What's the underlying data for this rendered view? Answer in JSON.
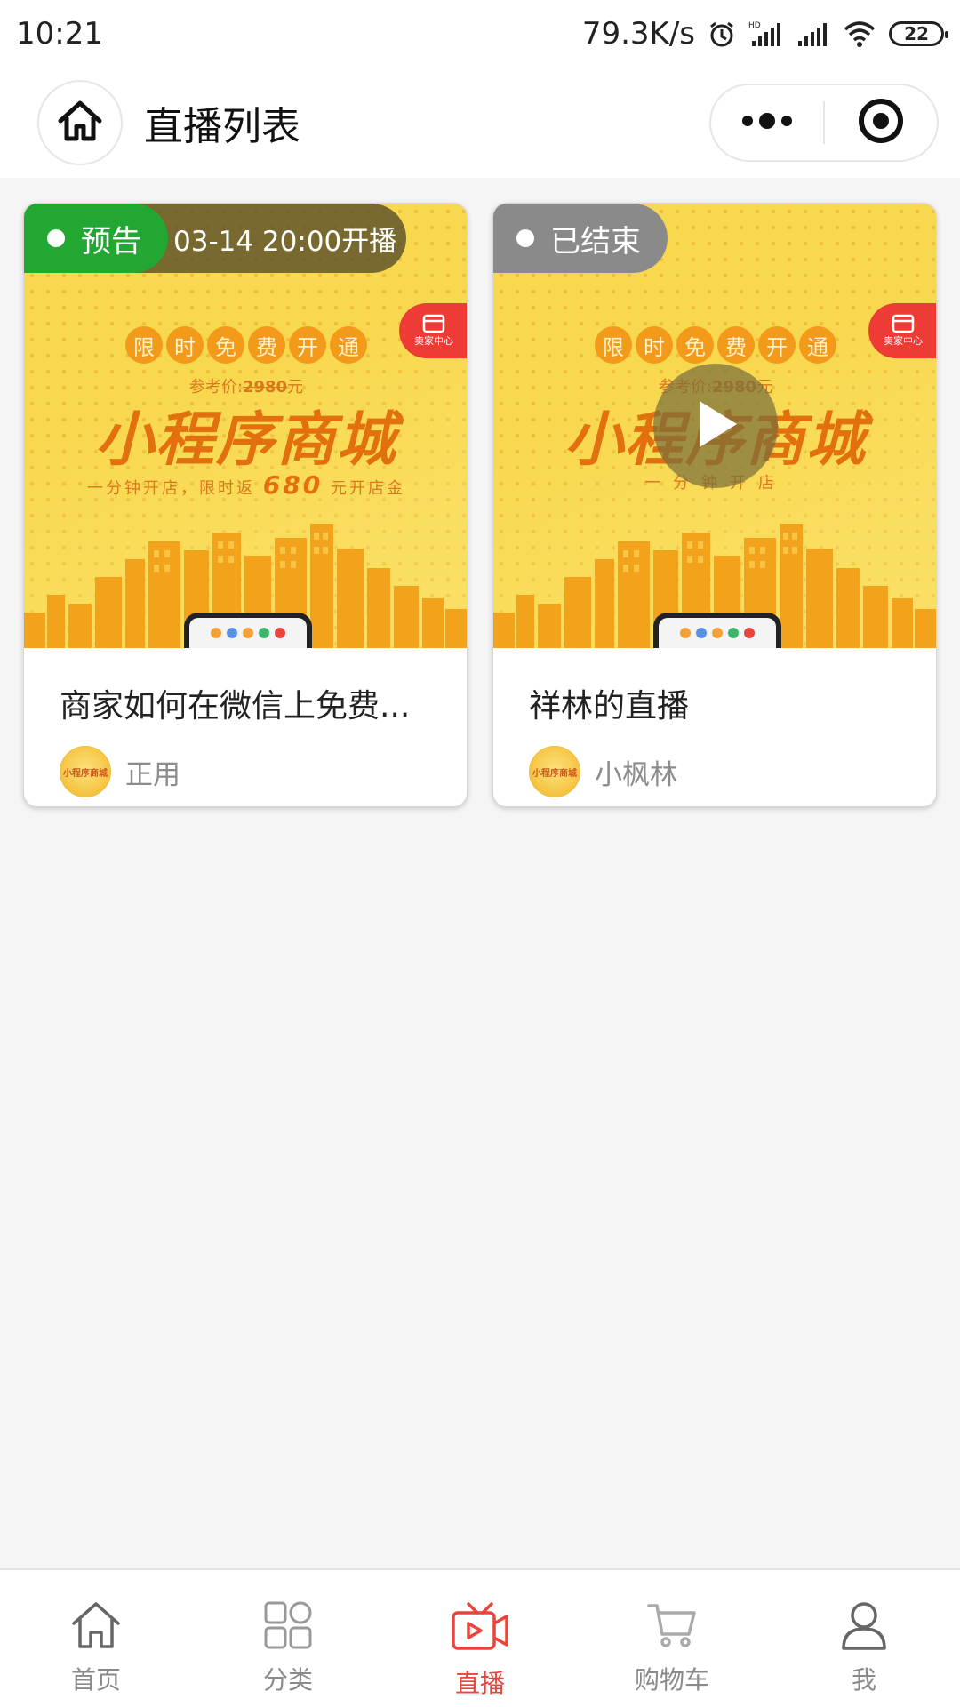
{
  "statusbar": {
    "time": "10:21",
    "speed": "79.3K/s",
    "battery": "22",
    "icons": [
      "alarm-icon",
      "hd-signal-icon",
      "signal-icon",
      "wifi-icon",
      "battery-icon"
    ]
  },
  "navbar": {
    "title": "直播列表",
    "home_icon": "home-icon",
    "more_icon": "more-dots-icon",
    "close_icon": "target-circle-icon"
  },
  "cards": [
    {
      "status": "预告",
      "status_color": "#22a832",
      "time_text": "03-14 20:00开播",
      "title": "商家如何在微信上免费...",
      "author": "正用",
      "cover": {
        "pills": [
          "限",
          "时",
          "免",
          "费",
          "开",
          "通"
        ],
        "ref_label": "参考价:",
        "ref_price": "2980",
        "ref_unit": "元",
        "headline": "小程序商城",
        "sub_prefix": "一分钟开店，限时返",
        "sub_amount": "680",
        "sub_suffix": "元开店金",
        "badge": "卖家中心"
      }
    },
    {
      "status": "已结束",
      "status_color": "#8a8a8a",
      "title": "祥林的直播",
      "author": "小枫林",
      "cover": {
        "pills": [
          "限",
          "时",
          "免",
          "费",
          "开",
          "通"
        ],
        "ref_label": "参考价:",
        "ref_price": "2980",
        "ref_unit": "元",
        "headline": "小程序商城",
        "sub_prefix": "一分钟开店",
        "badge": "卖家中心"
      }
    }
  ],
  "avatar_text": "小程序商城",
  "tabs": [
    {
      "label": "首页",
      "icon": "home-icon",
      "active": false
    },
    {
      "label": "分类",
      "icon": "category-icon",
      "active": false
    },
    {
      "label": "直播",
      "icon": "live-tv-icon",
      "active": true
    },
    {
      "label": "购物车",
      "icon": "cart-icon",
      "active": false
    },
    {
      "label": "我",
      "icon": "user-icon",
      "active": false
    }
  ],
  "colors": {
    "accent": "#e8453c",
    "preview_green": "#22a832",
    "ended_gray": "#8a8a8a",
    "cover_yellow": "#f8d84e",
    "cover_orange": "#e2700f"
  }
}
